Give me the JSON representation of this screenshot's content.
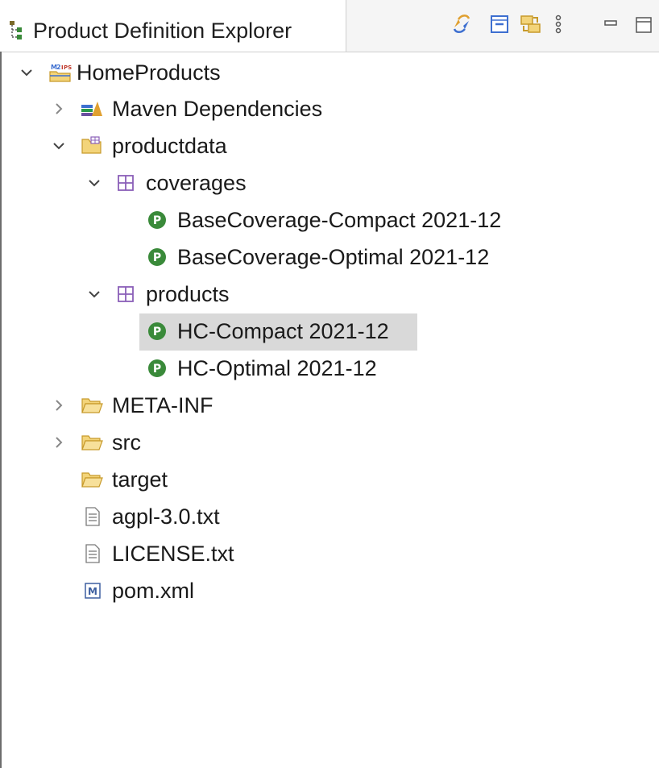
{
  "view": {
    "title": "Product Definition Explorer",
    "toolbar": [
      {
        "name": "sync-icon",
        "tooltip": ""
      },
      {
        "name": "collapse-all-icon",
        "tooltip": ""
      },
      {
        "name": "link-with-editor-icon",
        "tooltip": ""
      },
      {
        "name": "view-menu-icon",
        "tooltip": ""
      },
      {
        "name": "minimize-icon",
        "tooltip": ""
      },
      {
        "name": "maximize-icon",
        "tooltip": ""
      }
    ]
  },
  "tree": {
    "root": {
      "label": "HomeProducts",
      "icon": "project-icon",
      "expanded": true
    },
    "maven": {
      "label": "Maven Dependencies",
      "icon": "library-icon",
      "expanded": false
    },
    "productdata": {
      "label": "productdata",
      "icon": "source-folder-icon",
      "expanded": true
    },
    "coverages": {
      "label": "coverages",
      "icon": "package-icon",
      "expanded": true
    },
    "coverage_items": [
      {
        "label": "BaseCoverage-Compact 2021-12",
        "icon": "product-cmpt-icon"
      },
      {
        "label": "BaseCoverage-Optimal 2021-12",
        "icon": "product-cmpt-icon"
      }
    ],
    "products": {
      "label": "products",
      "icon": "package-icon",
      "expanded": true
    },
    "product_items": [
      {
        "label": "HC-Compact 2021-12",
        "icon": "product-cmpt-icon",
        "selected": true
      },
      {
        "label": "HC-Optimal 2021-12",
        "icon": "product-cmpt-icon",
        "selected": false
      }
    ],
    "meta_inf": {
      "label": "META-INF",
      "icon": "folder-icon",
      "expanded": false
    },
    "src": {
      "label": "src",
      "icon": "folder-icon",
      "expanded": false
    },
    "target": {
      "label": "target",
      "icon": "folder-icon"
    },
    "files": [
      {
        "label": "agpl-3.0.txt",
        "icon": "text-file-icon"
      },
      {
        "label": "LICENSE.txt",
        "icon": "text-file-icon"
      },
      {
        "label": "pom.xml",
        "icon": "maven-pom-icon"
      }
    ]
  },
  "colors": {
    "selection": "#d9d9d9",
    "product_green": "#3a8a3a",
    "folder_orange": "#e8a33a",
    "package_purple": "#8a5fb8"
  }
}
